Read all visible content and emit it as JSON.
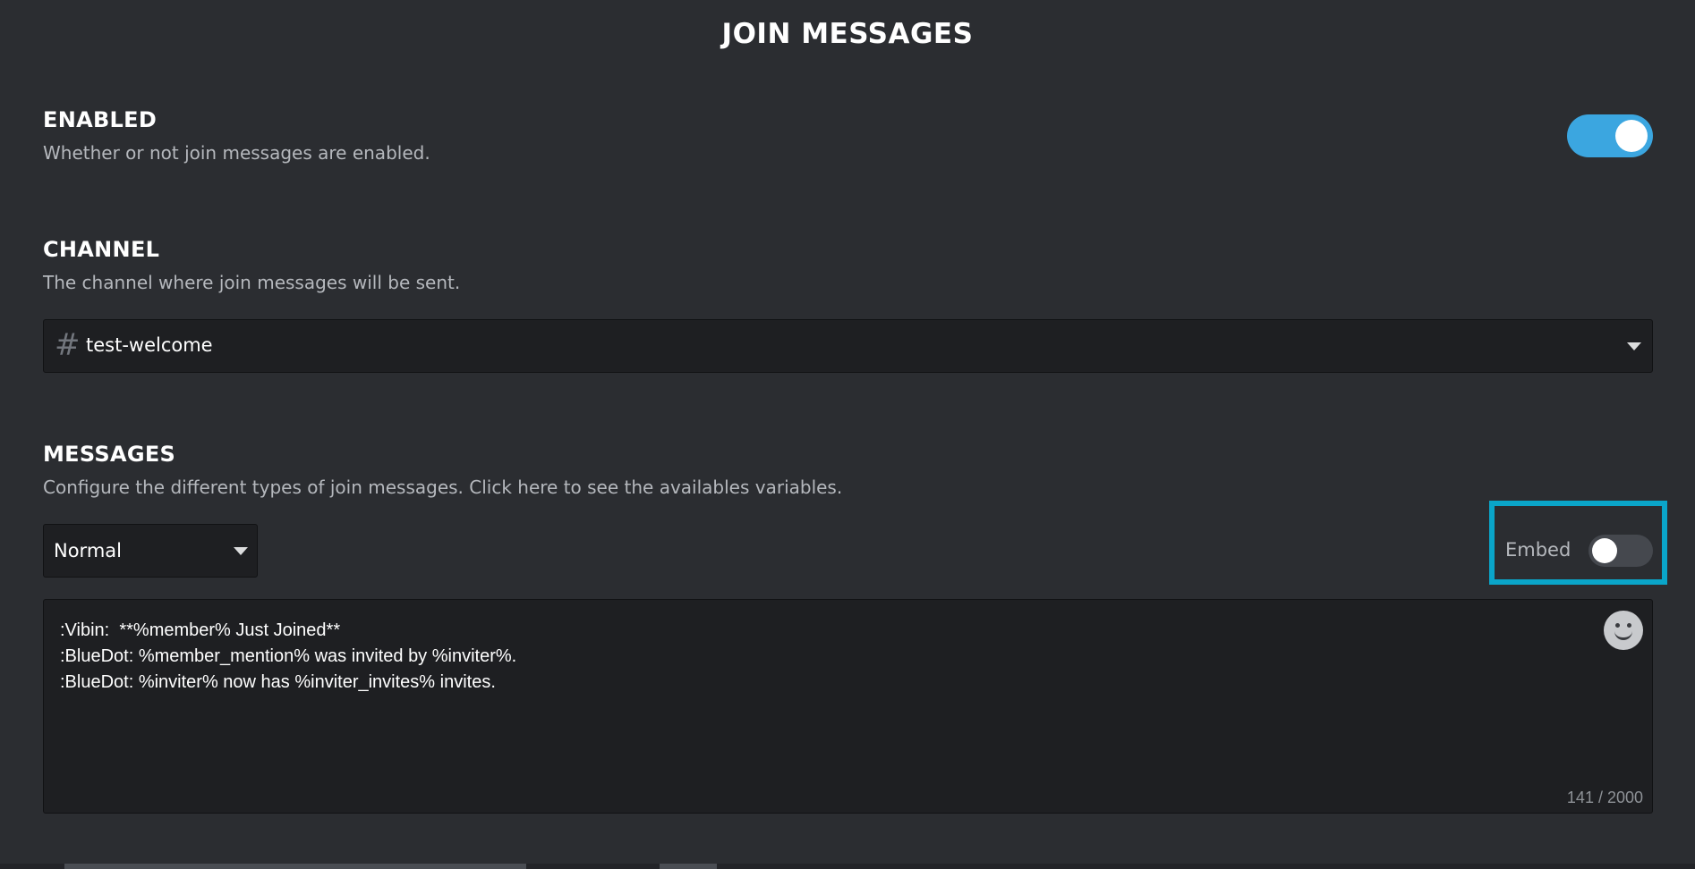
{
  "page": {
    "title": "JOIN MESSAGES"
  },
  "enabled": {
    "title": "ENABLED",
    "description": "Whether or not join messages are enabled.",
    "toggle_on": true
  },
  "channel": {
    "title": "CHANNEL",
    "description": "The channel where join messages will be sent.",
    "selected": "test-welcome",
    "icon": "hash-icon"
  },
  "messages": {
    "title": "MESSAGES",
    "description": "Configure the different types of join messages. Click here to see the availables variables.",
    "type_selected": "Normal",
    "embed_label": "Embed",
    "embed_on": false,
    "content": ":Vibin:  **%member% Just Joined**\n:BlueDot: %member_mention% was invited by %inviter%.\n:BlueDot: %inviter% now has %inviter_invites% invites.",
    "char_count": "141 / 2000"
  },
  "colors": {
    "background": "#2b2d31",
    "input_background": "#1e1f22",
    "toggle_on": "#3ba6e0",
    "highlight": "#0aa5c9"
  }
}
